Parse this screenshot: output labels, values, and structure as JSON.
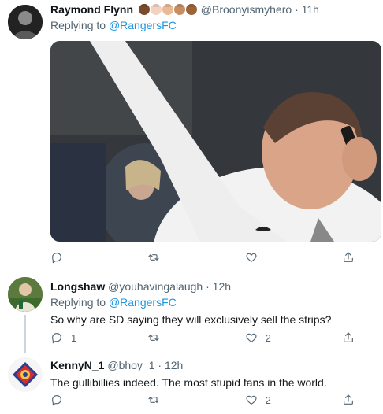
{
  "tweets": [
    {
      "name": "Raymond Flynn",
      "emoji_colors": [
        "#7a4a2c",
        "#f3d3c0",
        "#eab995",
        "#c68e62",
        "#9c6337"
      ],
      "handle": "@Broonyismyhero",
      "sep": "·",
      "time": "11h",
      "replying_prefix": "Replying to",
      "replying_to": "@RangersFC",
      "replies": "",
      "retweets": "",
      "likes": ""
    },
    {
      "name": "Longshaw",
      "handle": "@youhavingalaugh",
      "sep": "·",
      "time": "12h",
      "replying_prefix": "Replying to",
      "replying_to": "@RangersFC",
      "text": "So why are SD saying they will exclusively sell the strips?",
      "replies": "1",
      "retweets": "",
      "likes": "2"
    },
    {
      "name": "KennyN_1",
      "handle": "@bhoy_1",
      "sep": "·",
      "time": "12h",
      "text": "The gullibillies indeed. The most stupid fans in the world.",
      "replies": "",
      "retweets": "",
      "likes": "2"
    }
  ]
}
